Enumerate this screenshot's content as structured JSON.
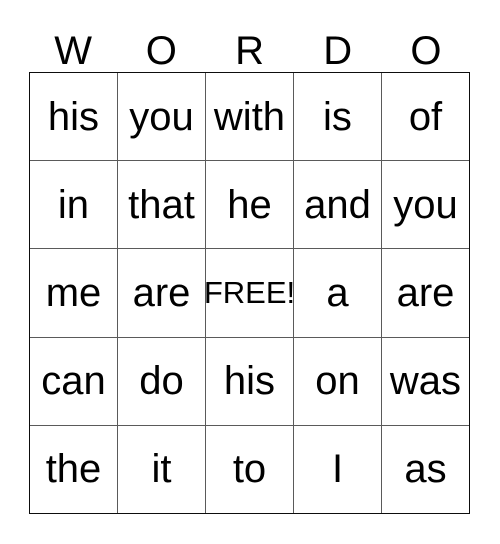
{
  "card": {
    "header_letters": [
      "W",
      "O",
      "R",
      "D",
      "O"
    ],
    "rows": [
      [
        "his",
        "you",
        "with",
        "is",
        "of"
      ],
      [
        "in",
        "that",
        "he",
        "and",
        "you"
      ],
      [
        "me",
        "are",
        "FREE!",
        "a",
        "are"
      ],
      [
        "can",
        "do",
        "his",
        "on",
        "was"
      ],
      [
        "the",
        "it",
        "to",
        "I",
        "as"
      ]
    ],
    "free_space": {
      "label": "FREE!",
      "row_index": 2,
      "column_index": 2
    },
    "colors": {
      "background": "#ffffff",
      "text": "#000000",
      "outer_border": "#0d0d0d",
      "inner_border": "#5a5a5a"
    }
  }
}
